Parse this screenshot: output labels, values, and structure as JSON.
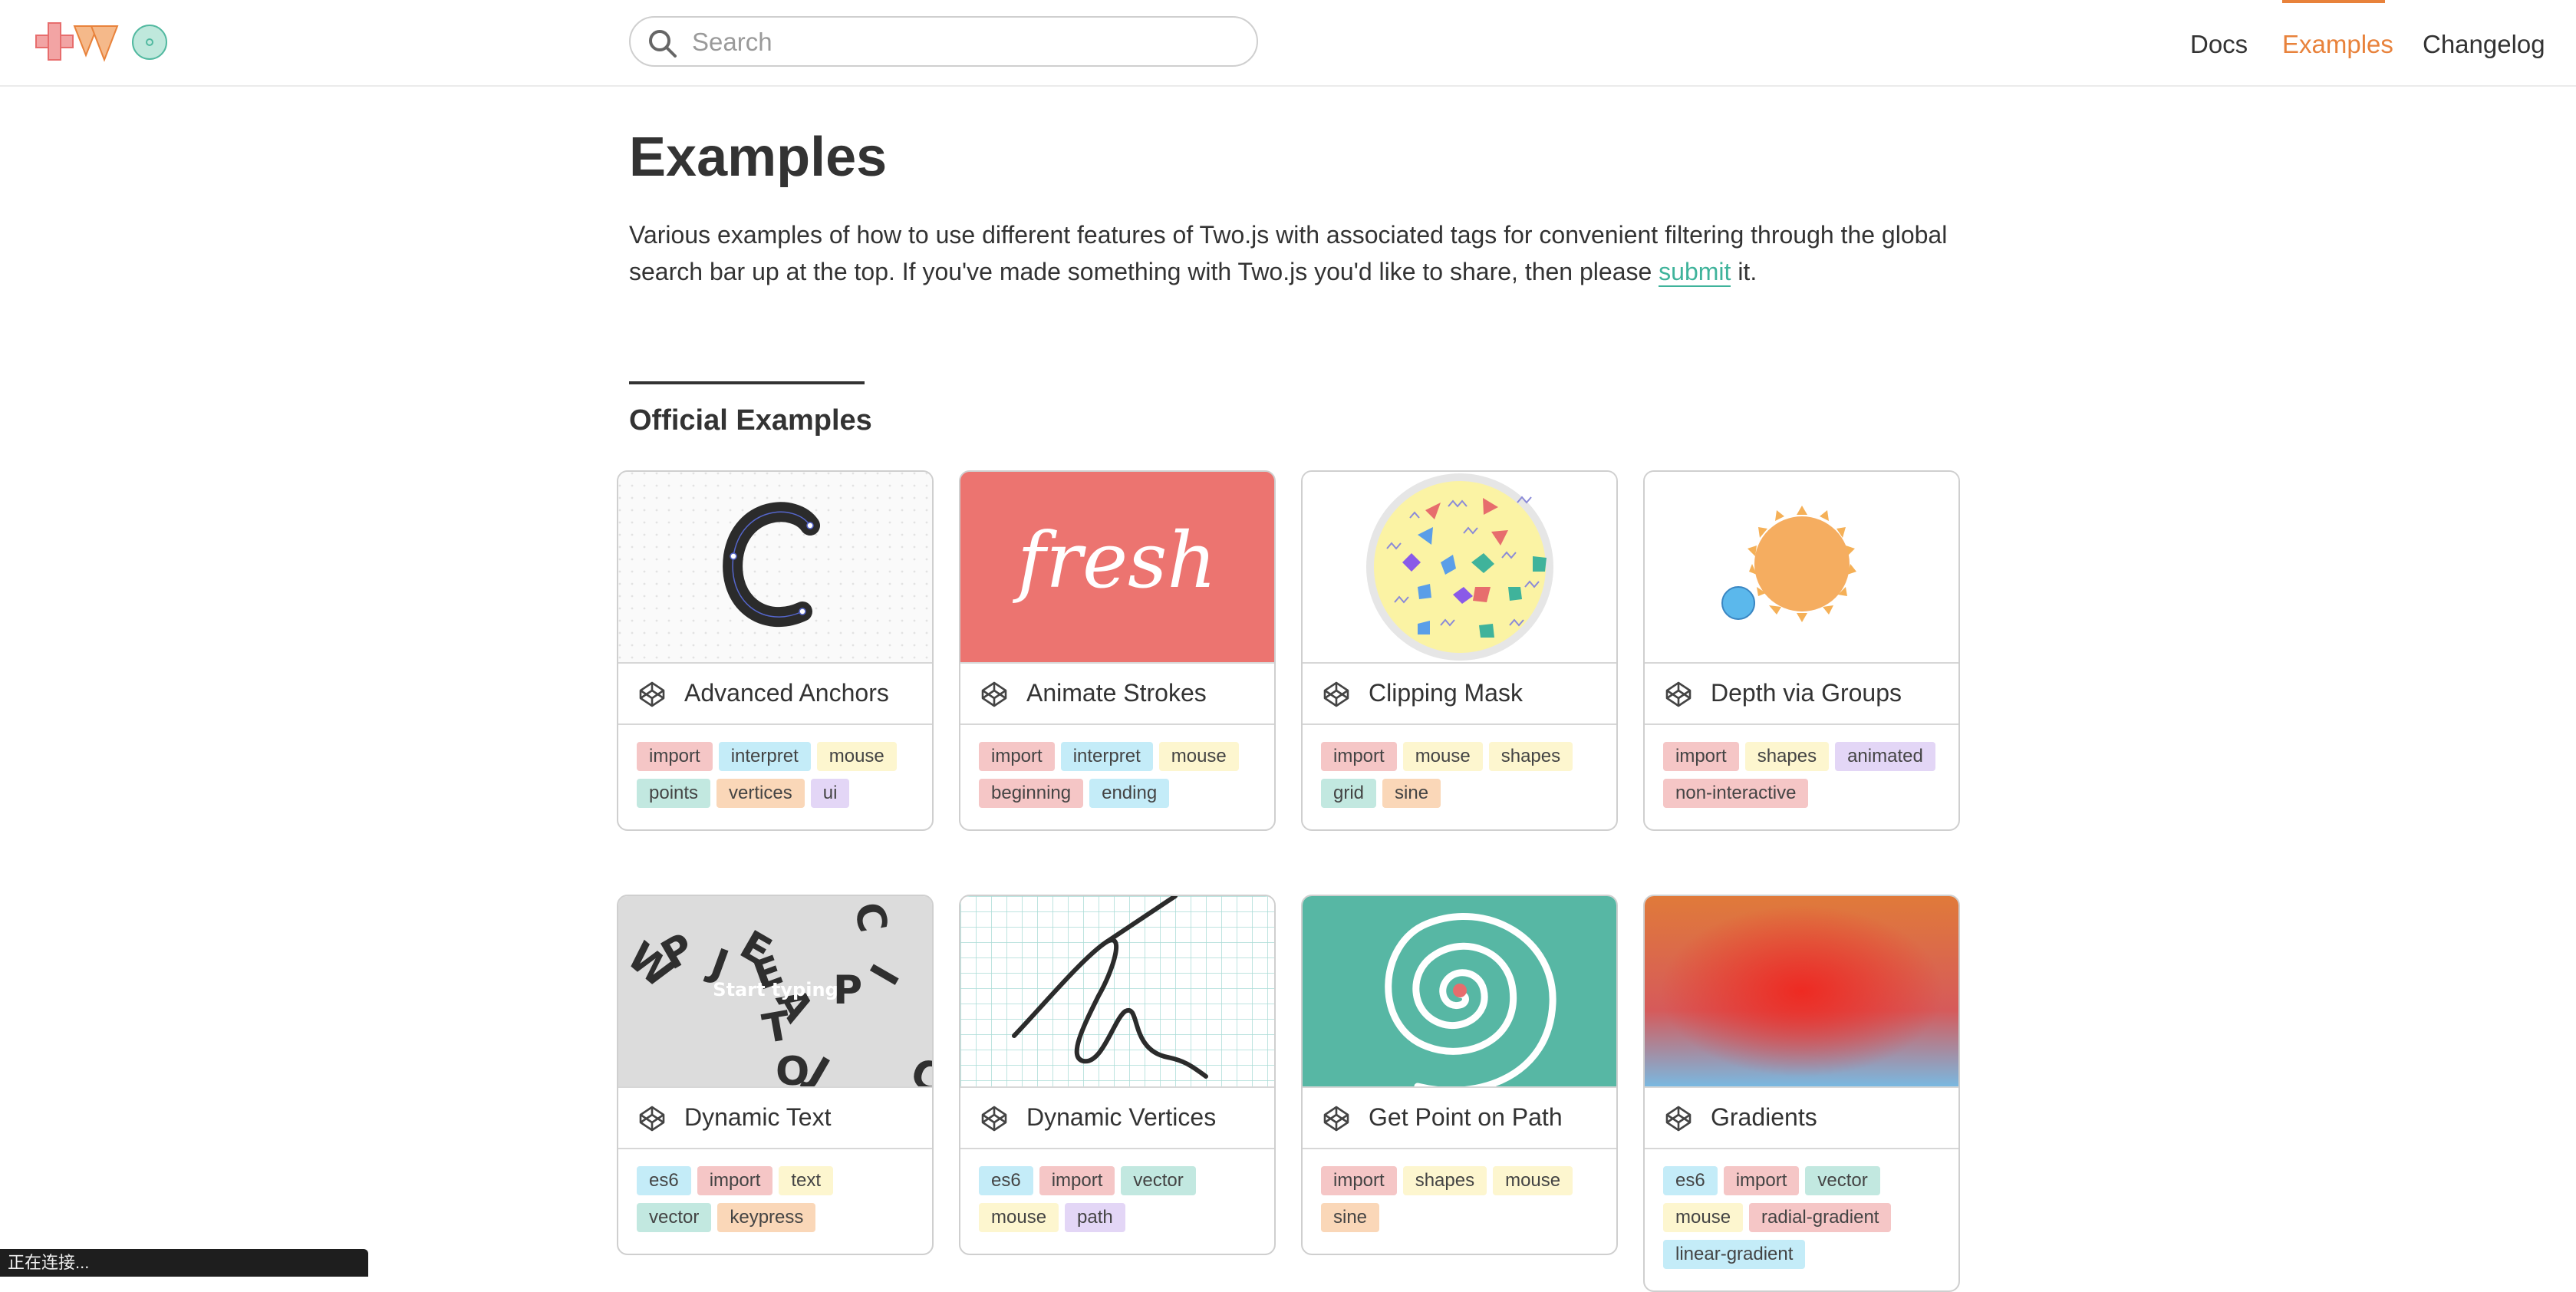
{
  "header": {
    "logo_alt": "two",
    "search_placeholder": "Search",
    "nav": [
      {
        "label": "Docs",
        "active": false
      },
      {
        "label": "Examples",
        "active": true
      },
      {
        "label": "Changelog",
        "active": false
      }
    ]
  },
  "page": {
    "title": "Examples",
    "intro_before": "Various examples of how to use different features of Two.js with associated tags for convenient filtering through the global search bar up at the top. If you've made something with Two.js you'd like to share, then please ",
    "intro_link": "submit",
    "intro_after": " it.",
    "section_title": "Official Examples"
  },
  "tag_colors": {
    "import": "#f5c6c6",
    "interpret": "#c4ecf8",
    "mouse": "#fdf6cf",
    "points": "#c2e8e0",
    "vertices": "#fad7b8",
    "ui": "#e3d6f6",
    "beginning": "#f5c6c6",
    "ending": "#c4ecf8",
    "shapes": "#fdf6cf",
    "grid": "#c2e8e0",
    "sine": "#fad7b8",
    "animated": "#e3d6f6",
    "non-interactive": "#f5c6c6",
    "es6": "#c4ecf8",
    "text": "#fdf6cf",
    "vector": "#c2e8e0",
    "keypress": "#fad7b8",
    "path": "#e3d6f6",
    "radial-gradient": "#f5c6c6",
    "linear-gradient": "#c4ecf8"
  },
  "examples": [
    {
      "title": "Advanced Anchors",
      "tags": [
        "import",
        "interpret",
        "mouse",
        "points",
        "vertices",
        "ui"
      ]
    },
    {
      "title": "Animate Strokes",
      "tags": [
        "import",
        "interpret",
        "mouse",
        "beginning",
        "ending"
      ],
      "thumb_text": "fresh"
    },
    {
      "title": "Clipping Mask",
      "tags": [
        "import",
        "mouse",
        "shapes",
        "grid",
        "sine"
      ]
    },
    {
      "title": "Depth via Groups",
      "tags": [
        "import",
        "shapes",
        "animated",
        "non-interactive"
      ]
    },
    {
      "title": "Dynamic Text",
      "tags": [
        "es6",
        "import",
        "text",
        "vector",
        "keypress"
      ],
      "thumb_text": "Start typing"
    },
    {
      "title": "Dynamic Vertices",
      "tags": [
        "es6",
        "import",
        "vector",
        "mouse",
        "path"
      ]
    },
    {
      "title": "Get Point on Path",
      "tags": [
        "import",
        "shapes",
        "mouse",
        "sine"
      ]
    },
    {
      "title": "Gradients",
      "tags": [
        "es6",
        "import",
        "vector",
        "mouse",
        "radial-gradient",
        "linear-gradient"
      ]
    }
  ],
  "status": {
    "text": "正在连接..."
  }
}
